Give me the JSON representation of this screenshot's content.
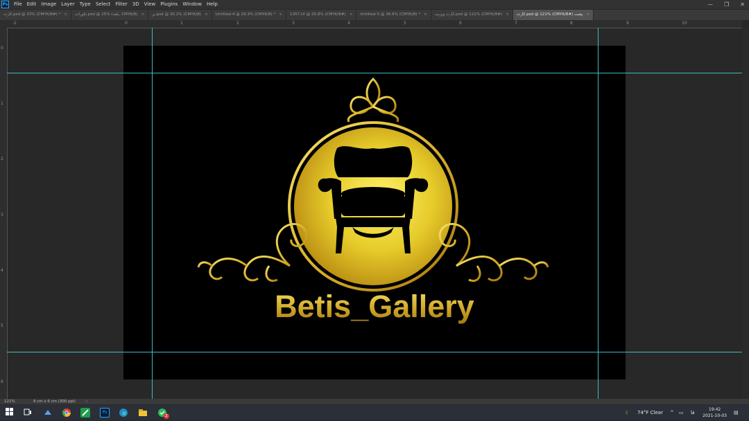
{
  "app": {
    "logo": "Ps"
  },
  "menu": [
    "File",
    "Edit",
    "Image",
    "Layer",
    "Type",
    "Select",
    "Filter",
    "3D",
    "View",
    "Plugins",
    "Window",
    "Help"
  ],
  "window_controls": {
    "minimize": "—",
    "restore": "❐",
    "close": "✕"
  },
  "tabs": [
    {
      "label": "کارت.psd @ 33% (CMYK/8#) *",
      "active": false
    },
    {
      "label": "نکورات.psd @ 25% (بلعد, CMYK/8)",
      "active": false
    },
    {
      "label": "بر.psd @ 30.2% (CMYK/8)",
      "active": false
    },
    {
      "label": "Untitled-4 @ 29.3% (CMYK/8) *",
      "active": false
    },
    {
      "label": "1357.tif @ 25.8% (CMYK/8#)",
      "active": false
    },
    {
      "label": "Untitled-5 @ 36.6% (CMYK/8) *",
      "active": false
    },
    {
      "label": "کارت ویزیت.psd @ 121% (CMYK/8#)",
      "active": false
    },
    {
      "label": "کارت.psd @ 121% (CMYK/8#) پشت",
      "active": true
    }
  ],
  "tab_close": "×",
  "ruler_h": [
    "-2",
    "0",
    "1",
    "2",
    "3",
    "4",
    "5",
    "6",
    "7",
    "8",
    "9",
    "10"
  ],
  "ruler_v": [
    "0",
    "1",
    "2",
    "3",
    "4",
    "5",
    "6"
  ],
  "artwork": {
    "brand_name": "Betis_Gallery",
    "colors": {
      "gold_light": "#f6ea4a",
      "gold_dark": "#b88a12",
      "background": "#000000",
      "guide": "#3fbcc4"
    }
  },
  "status": {
    "zoom": "121%",
    "doc_size": "9 cm x 6 cm (300 ppi)",
    "arrow": "›"
  },
  "taskbar": {
    "apps": [
      "windows-start",
      "task-view",
      "vpn",
      "chrome",
      "excel-like",
      "photoshop",
      "edge",
      "file-explorer",
      "chat"
    ],
    "chat_badge": "2",
    "weather": "74°F  Clear",
    "lang": "فا",
    "time": "19:42",
    "date": "2021-10-03"
  }
}
